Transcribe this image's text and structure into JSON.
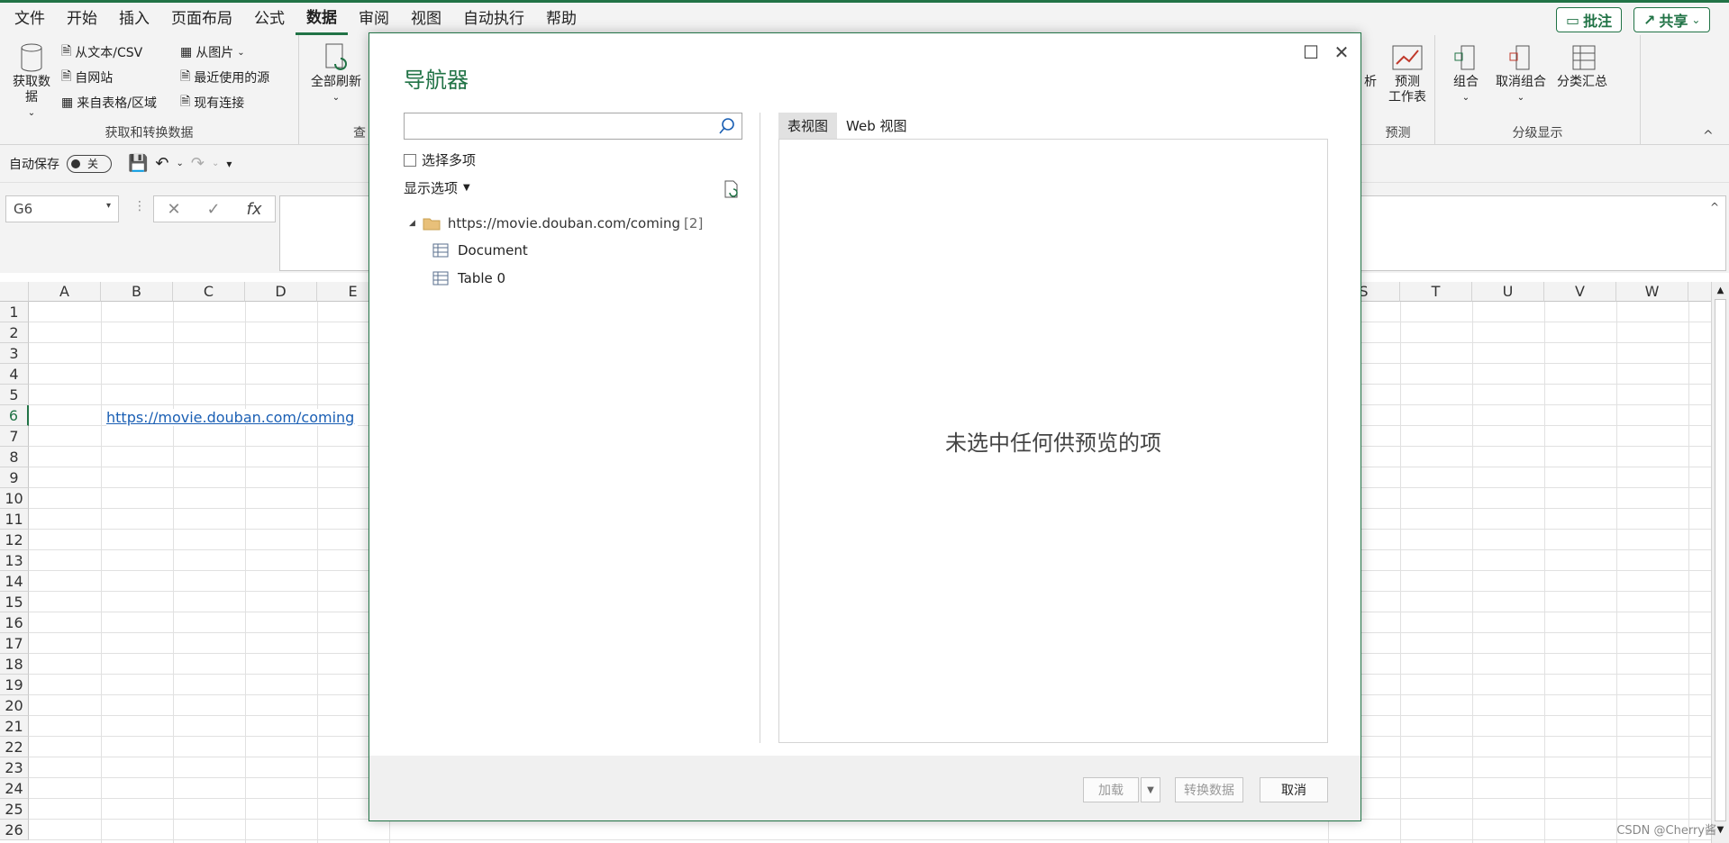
{
  "menu": {
    "items": [
      "文件",
      "开始",
      "插入",
      "页面布局",
      "公式",
      "数据",
      "审阅",
      "视图",
      "自动执行",
      "帮助"
    ],
    "active_index": 5,
    "comment_label": "批注",
    "share_label": "共享"
  },
  "ribbon": {
    "get_data_label": "获取数\n据",
    "from_text_csv": "从文本/CSV",
    "from_web": "自网站",
    "from_table": "来自表格/区域",
    "from_picture": "从图片",
    "recent_sources": "最近使用的源",
    "existing_connections": "现有连接",
    "group_get_transform": "获取和转换数据",
    "refresh_all": "全部刷新",
    "group_query_partial": "查",
    "analysis_partial": "析",
    "forecast_sheet": "预测\n工作表",
    "group_forecast": "预测",
    "group_btn": "组合",
    "ungroup_btn": "取消组合",
    "subtotal_btn": "分类汇总",
    "group_outline": "分级显示"
  },
  "qat": {
    "autosave_label": "自动保存",
    "toggle_state": "关"
  },
  "formula": {
    "name_box": "G6",
    "fx": "fx",
    "content": ""
  },
  "grid": {
    "left_columns": [
      "A",
      "B",
      "C",
      "D",
      "E"
    ],
    "right_columns": [
      "S",
      "T",
      "U",
      "V",
      "W"
    ],
    "rows": [
      "1",
      "2",
      "3",
      "4",
      "5",
      "6",
      "7",
      "8",
      "9",
      "10",
      "11",
      "12",
      "13",
      "14",
      "15",
      "16",
      "17",
      "18",
      "19",
      "20",
      "21",
      "22",
      "23",
      "24",
      "25",
      "26"
    ],
    "cell_b6": "https://movie.douban.com/coming"
  },
  "navigator": {
    "title": "导航器",
    "search_placeholder": "",
    "select_multiple": "选择多项",
    "display_options": "显示选项",
    "root_label": "https://movie.douban.com/coming",
    "root_count": "[2]",
    "items": [
      "Document",
      "Table 0"
    ],
    "tabs": [
      "表视图",
      "Web 视图"
    ],
    "preview_empty": "未选中任何供预览的项",
    "load_btn": "加载",
    "transform_btn": "转换数据",
    "cancel_btn": "取消"
  },
  "watermark": "CSDN @Cherry酱",
  "colors": {
    "accent": "#217346",
    "link": "#1a5fb4"
  }
}
